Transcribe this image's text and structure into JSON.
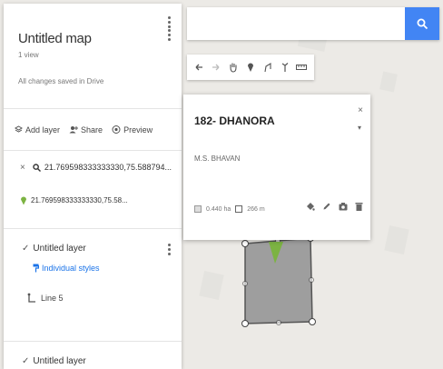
{
  "map": {
    "title": "Untitled map",
    "views": "1 view",
    "save_status": "All changes saved in Drive"
  },
  "actions": {
    "add_layer": "Add layer",
    "share": "Share",
    "preview": "Preview"
  },
  "search": {
    "query_result": "21.769598333333330,75.588794...",
    "place_result": "21.769598333333330,75.58...",
    "placeholder": ""
  },
  "layers": [
    {
      "name": "Untitled layer",
      "style": "Individual styles",
      "feature": "Line 5"
    },
    {
      "name": "Untitled layer"
    }
  ],
  "info_window": {
    "title": "182- DHANORA",
    "owner": "M.S. BHAVAN",
    "area": "0.440 ha",
    "length": "266 m"
  },
  "colors": {
    "accent": "#4285f4",
    "pin": "#7cb342",
    "polygon_fill": "#9e9e9e",
    "polygon_stroke": "#555555"
  },
  "icons": {
    "toolbar": [
      "undo-icon",
      "redo-icon",
      "hand-icon",
      "marker-icon",
      "polygon-icon",
      "directions-icon",
      "ruler-icon"
    ]
  }
}
